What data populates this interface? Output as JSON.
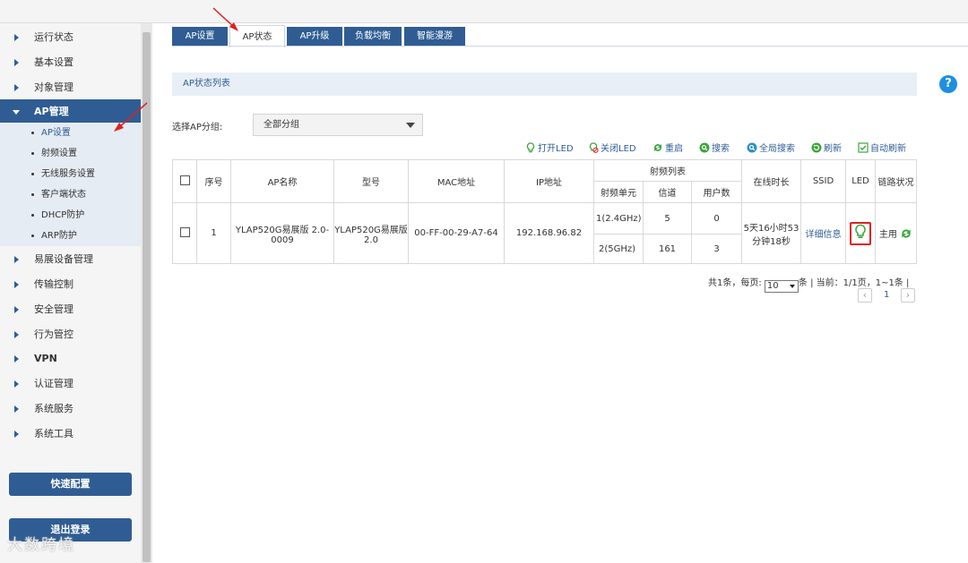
{
  "sidebar": {
    "items": [
      {
        "label": "运行状态"
      },
      {
        "label": "基本设置"
      },
      {
        "label": "对象管理"
      },
      {
        "label": "AP管理"
      },
      {
        "label": "易展设备管理"
      },
      {
        "label": "传输控制"
      },
      {
        "label": "安全管理"
      },
      {
        "label": "行为管控"
      },
      {
        "label": "VPN"
      },
      {
        "label": "认证管理"
      },
      {
        "label": "系统服务"
      },
      {
        "label": "系统工具"
      }
    ],
    "sub_items": [
      {
        "label": "AP设置"
      },
      {
        "label": "射频设置"
      },
      {
        "label": "无线服务设置"
      },
      {
        "label": "客户端状态"
      },
      {
        "label": "DHCP防护"
      },
      {
        "label": "ARP防护"
      }
    ],
    "quick_config": "快速配置",
    "logout": "退出登录",
    "watermark": "大数跨境"
  },
  "tabs": [
    {
      "label": "AP设置"
    },
    {
      "label": "AP状态"
    },
    {
      "label": "AP升级"
    },
    {
      "label": "负载均衡"
    },
    {
      "label": "智能漫游"
    }
  ],
  "help": "?",
  "section_title": "AP状态列表",
  "filter": {
    "label": "选择AP分组:",
    "value": "全部分组"
  },
  "toolbar": {
    "led_on": "打开LED",
    "led_off": "关闭LED",
    "restart": "重启",
    "search": "搜索",
    "global_search": "全局搜索",
    "refresh": "刷新",
    "auto_refresh": "自动刷新"
  },
  "colors": {
    "primary": "#2f5d93",
    "accent_green": "#3aa83a",
    "highlight_red": "#e02020"
  },
  "table": {
    "headers": {
      "seq": "序号",
      "name": "AP名称",
      "model": "型号",
      "mac": "MAC地址",
      "ip": "IP地址",
      "rf_list": "射频列表",
      "rf_unit": "射频单元",
      "channel": "信道",
      "users": "用户数",
      "uptime": "在线时长",
      "ssid": "SSID",
      "led": "LED",
      "link": "链路状况"
    },
    "rows": [
      {
        "seq": "1",
        "name": "YLAP520G易展版 2.0-0009",
        "model": "YLAP520G易展版 2.0",
        "mac": "00-FF-00-29-A7-64",
        "ip": "192.168.96.82",
        "rf": [
          {
            "unit": "1(2.4GHz)",
            "channel": "5",
            "users": "0"
          },
          {
            "unit": "2(5GHz)",
            "channel": "161",
            "users": "3"
          }
        ],
        "uptime": "5天16小时53分钟18秒",
        "ssid": "详细信息",
        "led_icon": "bulb-icon",
        "link": "主用"
      }
    ]
  },
  "pager": {
    "total": "共1条，每页:",
    "page_size": "10",
    "suffix": "条 | 当前：1/1页，1~1条 |",
    "page": "1",
    "prev": "‹",
    "next": "›"
  }
}
